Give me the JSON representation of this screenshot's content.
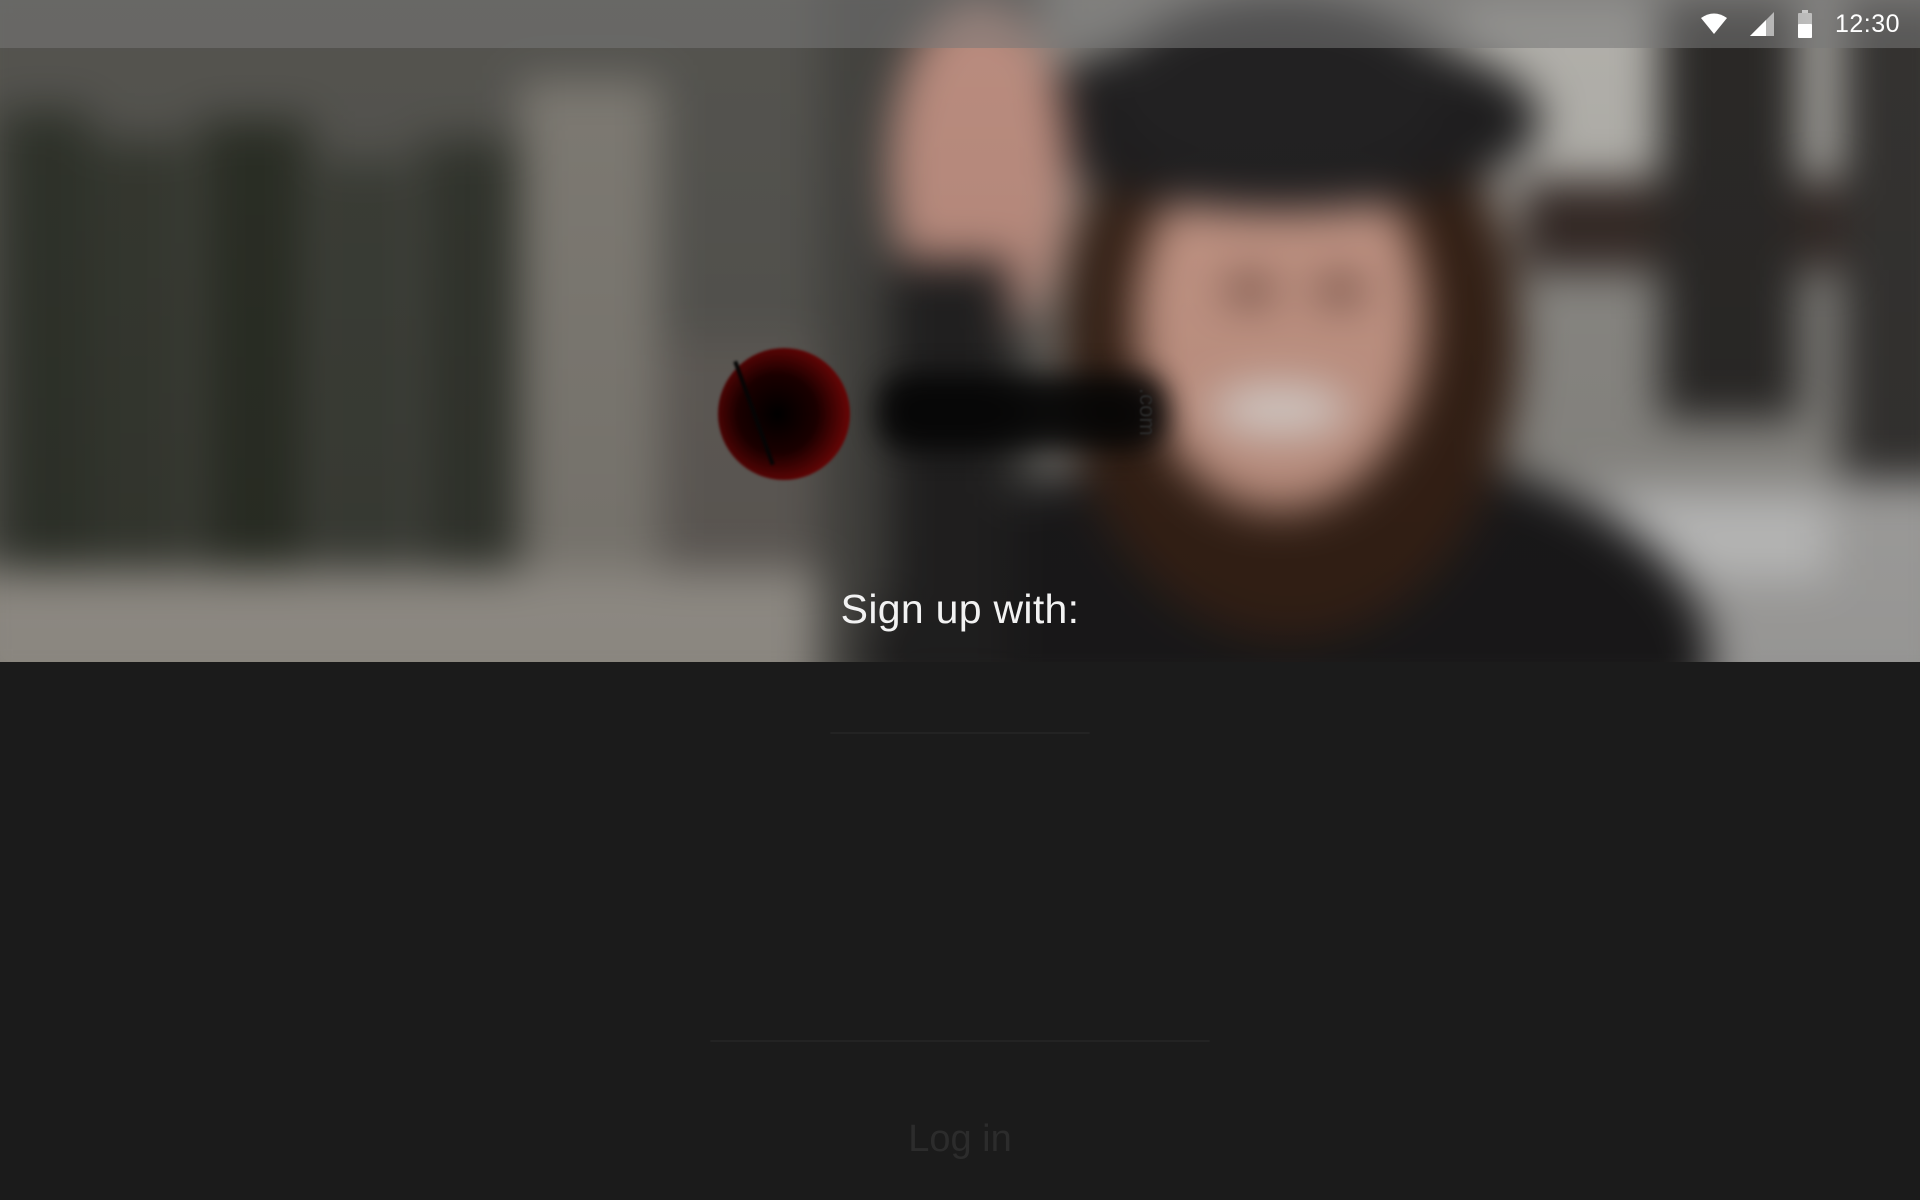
{
  "status_bar": {
    "time": "12:30",
    "icons": [
      "wifi-icon",
      "cellular-signal-icon",
      "battery-icon"
    ]
  },
  "logo": {
    "suffix": ".com"
  },
  "signup": {
    "prompt": "Sign up with:"
  },
  "login": {
    "label": "Log in"
  },
  "colors": {
    "panel_background": "#1b1b1b",
    "prompt_text": "#f2f2f2",
    "logo_red": "#8a1010",
    "login_text": "#2c2c2c"
  }
}
